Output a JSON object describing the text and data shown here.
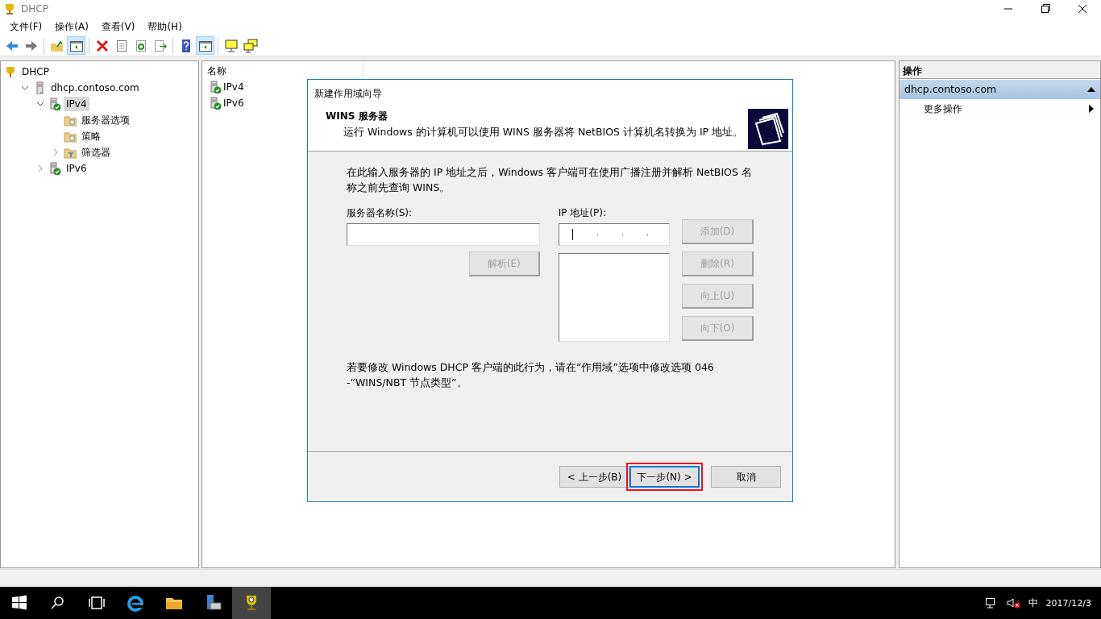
{
  "window": {
    "title": "DHCP"
  },
  "menu": [
    "文件(F)",
    "操作(A)",
    "查看(V)",
    "帮助(H)"
  ],
  "toolbar": [
    {
      "kind": "back",
      "pressed": false
    },
    {
      "kind": "forward",
      "pressed": false
    },
    {
      "kind": "sep"
    },
    {
      "kind": "up",
      "pressed": false
    },
    {
      "kind": "pane",
      "pressed": true
    },
    {
      "kind": "sep"
    },
    {
      "kind": "delete",
      "pressed": false
    },
    {
      "kind": "props",
      "pressed": false
    },
    {
      "kind": "refresh",
      "pressed": false
    },
    {
      "kind": "export",
      "pressed": false
    },
    {
      "kind": "sep"
    },
    {
      "kind": "help",
      "pressed": false
    },
    {
      "kind": "pane",
      "pressed": true
    },
    {
      "kind": "sep"
    },
    {
      "kind": "monitor",
      "pressed": false
    },
    {
      "kind": "monitors",
      "pressed": false
    }
  ],
  "tree": [
    {
      "label": "DHCP",
      "kind": "dhcp",
      "selected": false,
      "children": [
        {
          "label": "dhcp.contoso.com",
          "kind": "server",
          "expanded": true,
          "selected": false,
          "children": [
            {
              "label": "IPv4",
              "kind": "ok",
              "expanded": true,
              "selected": true,
              "children": [
                {
                  "label": "服务器选项",
                  "kind": "folder",
                  "selected": false
                },
                {
                  "label": "策略",
                  "kind": "folder",
                  "selected": false
                },
                {
                  "label": "筛选器",
                  "kind": "filter",
                  "expanded": false,
                  "selected": false
                }
              ]
            },
            {
              "label": "IPv6",
              "kind": "ok",
              "expanded": false,
              "selected": false
            }
          ]
        }
      ]
    }
  ],
  "list": {
    "column": "名称",
    "items": [
      "IPv4",
      "IPv6"
    ]
  },
  "actions": {
    "title": "操作",
    "group": "dhcp.contoso.com",
    "items": [
      "更多操作"
    ]
  },
  "dialog": {
    "title": "新建作用域向导",
    "heading": "WINS 服务器",
    "subheading": "运行 Windows 的计算机可以使用 WINS 服务器将 NetBIOS 计算机名转换为 IP 地址。",
    "intro": "在此输入服务器的 IP 地址之后，Windows 客户端可在使用广播注册并解析 NetBIOS 名称之前先查询 WINS。",
    "server_label": "服务器名称(S):",
    "resolve": {
      "label": "解析(E)",
      "disabled": true
    },
    "ip_label": "IP 地址(P):",
    "side_buttons": [
      {
        "label": "添加(D)",
        "disabled": true
      },
      {
        "label": "删除(R)",
        "disabled": true
      },
      {
        "label": "向上(U)",
        "disabled": true
      },
      {
        "label": "向下(O)",
        "disabled": true
      }
    ],
    "note": "若要修改 Windows DHCP 客户端的此行为，请在“作用域”选项中修改选项 046 -“WINS/NBT 节点类型”。",
    "buttons": [
      {
        "label": "< 上一步(B)",
        "focused": false
      },
      {
        "label": "下一步(N) >",
        "focused": true
      },
      {
        "label": "取消",
        "focused": false
      }
    ]
  },
  "taskbar": {
    "ime": "中",
    "date": "2017/12/3"
  }
}
